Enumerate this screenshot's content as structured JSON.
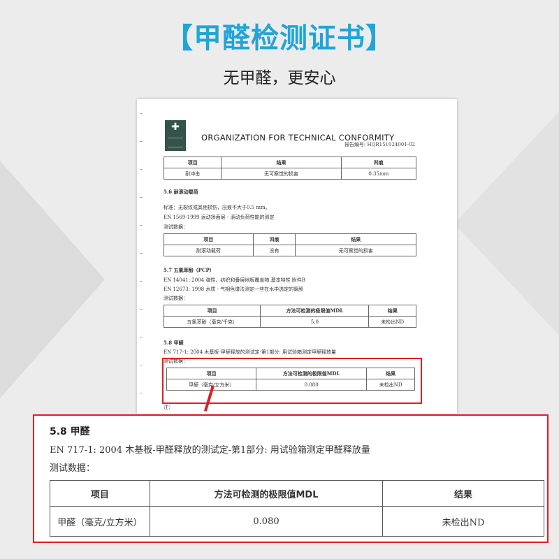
{
  "headline": "【甲醛检测证书】",
  "subhead": "无甲醛，更安心",
  "certificate": {
    "organization": "ORGANIZATION FOR TECHNICAL CONFORMITY",
    "report_no": "报告编号: HQR151024001-02",
    "table1": {
      "headers": [
        "项目",
        "结果",
        "凹痕"
      ],
      "row": [
        "耐冲击",
        "无可察觉的损害",
        "0.35mm"
      ]
    },
    "section56": {
      "title": "5.6 耐滚动载荷",
      "lines": [
        "标准：无裂纹或其他损伤，压痕不大于0.5 mm。",
        "EN 1569-1999  运动场面层 - 滚动负荷性能的测定",
        "测试数据："
      ],
      "headers": [
        "项目",
        "凹痕",
        "结果"
      ],
      "row": [
        "耐滚动载荷",
        "没有",
        "无可察觉的损害"
      ]
    },
    "section57": {
      "title": "5.7  五氯苯酚（PCP）",
      "lines": [
        "EN 14041: 2004  弹性、纺织和叠层地板覆盖物.基本特性  附件B",
        "EN 12673: 1998  水质 - 气相色谱法测定一些在水中选定的氯酚"
      ],
      "label": "测试数据：",
      "headers": [
        "项目",
        "方法可检测的极限值MDL",
        "结果"
      ],
      "row": [
        "五氯苯酚（毫克/千克）",
        "5.0",
        "未检出ND"
      ]
    },
    "section58": {
      "title": "5.8  甲醛",
      "line": "EN 717-1: 2004  木基板-甲醛释放的测试定-第1部分: 用试验箱测定甲醛释放量",
      "label": "测试数据：",
      "headers": [
        "项目",
        "方法可检测的极限值MDL",
        "结果"
      ],
      "row": [
        "甲醛（毫克/立方米）",
        "0.080",
        "未检出ND"
      ]
    },
    "note": "注："
  },
  "zoom": {
    "title": "5.8   甲醛",
    "standard": "EN 717-1: 2004  木基板-甲醛释放的测试定-第1部分: 用试验箱测定甲醛释放量",
    "label": "测试数据：",
    "headers": [
      "项目",
      "方法可检测的极限值MDL",
      "结果"
    ],
    "row": [
      "甲醛（毫克/立方米）",
      "0.080",
      "未检出ND"
    ]
  },
  "colors": {
    "accent": "#1fa6d6",
    "highlight": "#e11d25"
  },
  "icons": [
    "logo-emblem-icon"
  ]
}
